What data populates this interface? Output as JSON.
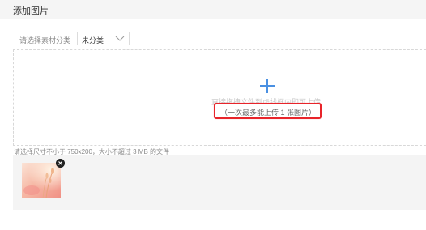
{
  "header": {
    "title": "添加图片"
  },
  "category": {
    "label": "请选择素材分类",
    "selected": "未分类",
    "chevron_icon": "chevron-down-icon"
  },
  "upload": {
    "plus_icon": "plus-icon",
    "hint_main": "直接拖拽文件到虚线框内即可上传",
    "hint_limit": "（一次最多能上传 1 张图片）",
    "accent_color": "#4a90e2",
    "highlight_color": "#e8242a"
  },
  "size_hint": "请选择尺寸不小于 750x200，大小不超过 3 MB 的文件",
  "preview": {
    "remove_icon": "close-icon"
  }
}
